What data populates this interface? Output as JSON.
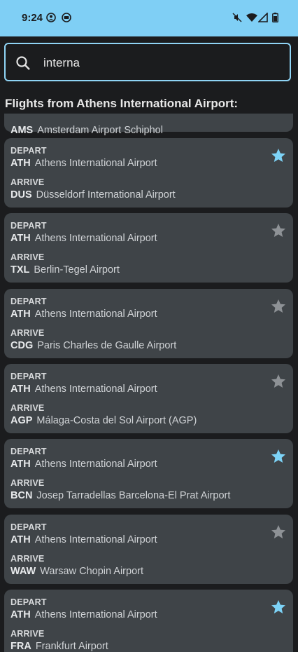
{
  "status": {
    "time": "9:24",
    "icons": [
      "account-circle-icon",
      "android-icon",
      "mute-icon",
      "wifi-icon",
      "signal-icon",
      "battery-icon"
    ]
  },
  "search": {
    "value": "interna",
    "icon": "search-icon"
  },
  "heading": "Flights from Athens International Airport:",
  "labels": {
    "depart": "DEPART",
    "arrive": "ARRIVE"
  },
  "partial": {
    "code": "AMS",
    "name": "Amsterdam Airport Schiphol"
  },
  "colors": {
    "favorite": "#7dd3f7",
    "not_favorite": "#8e9296",
    "card": "#3f4448",
    "status_bar": "#7fcff5"
  },
  "flights": [
    {
      "depart_code": "ATH",
      "depart_name": "Athens International Airport",
      "arrive_code": "DUS",
      "arrive_name": "Düsseldorf International Airport",
      "favorite": true
    },
    {
      "depart_code": "ATH",
      "depart_name": "Athens International Airport",
      "arrive_code": "TXL",
      "arrive_name": "Berlin-Tegel Airport",
      "favorite": false
    },
    {
      "depart_code": "ATH",
      "depart_name": "Athens International Airport",
      "arrive_code": "CDG",
      "arrive_name": "Paris Charles de Gaulle Airport",
      "favorite": false
    },
    {
      "depart_code": "ATH",
      "depart_name": "Athens International Airport",
      "arrive_code": "AGP",
      "arrive_name": "Málaga-Costa del Sol Airport (AGP)",
      "favorite": false
    },
    {
      "depart_code": "ATH",
      "depart_name": "Athens International Airport",
      "arrive_code": "BCN",
      "arrive_name": "Josep Tarradellas Barcelona-El Prat Airport",
      "favorite": true
    },
    {
      "depart_code": "ATH",
      "depart_name": "Athens International Airport",
      "arrive_code": "WAW",
      "arrive_name": "Warsaw Chopin Airport",
      "favorite": false
    },
    {
      "depart_code": "ATH",
      "depart_name": "Athens International Airport",
      "arrive_code": "FRA",
      "arrive_name": "Frankfurt Airport",
      "favorite": true
    }
  ]
}
